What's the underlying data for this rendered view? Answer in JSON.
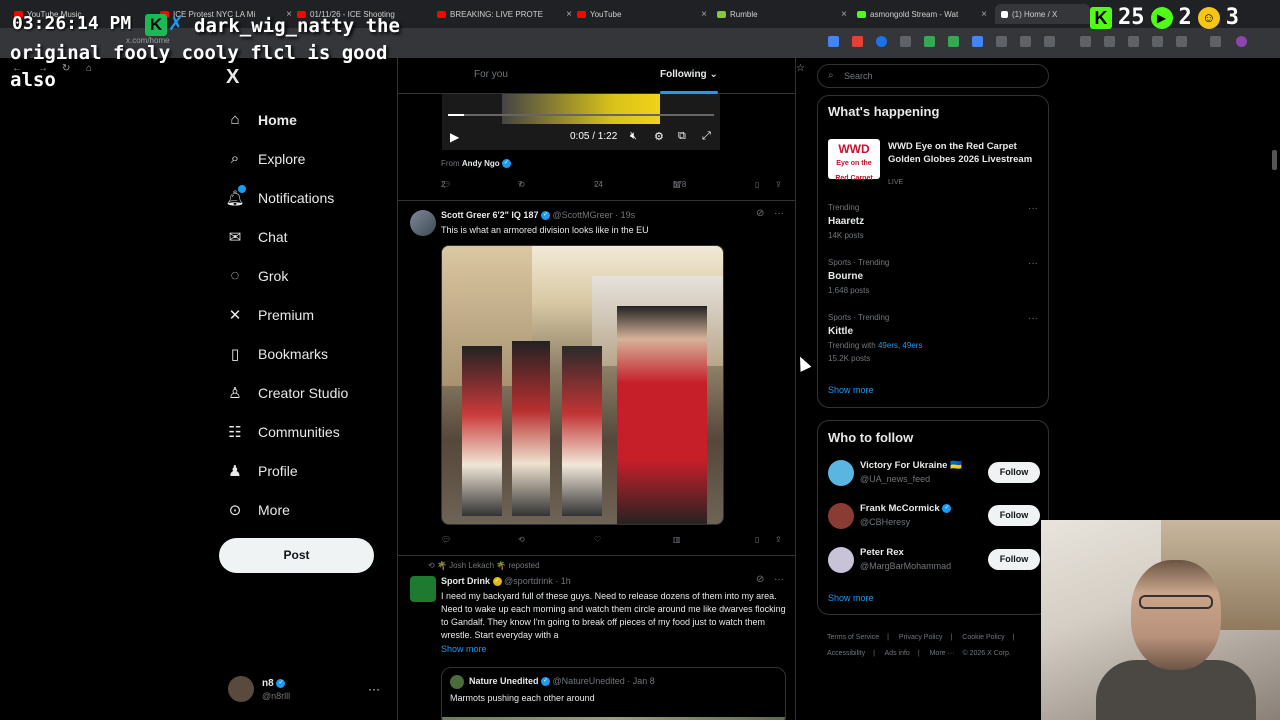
{
  "browser": {
    "tabs": [
      {
        "title": "YouTube Music",
        "color": "#ff0000"
      },
      {
        "title": "ICE Protest NYC LA Mi",
        "color": "#ff0000"
      },
      {
        "title": "01/11/26 - ICE Shooting",
        "color": "#ff0000"
      },
      {
        "title": "BREAKING: LIVE PROTE",
        "color": "#ff0000"
      },
      {
        "title": "YouTube",
        "color": "#ff0000"
      },
      {
        "title": "Rumble",
        "color": "#85c742"
      },
      {
        "title": "asmongold Stream - Wat",
        "color": "#53fc18"
      },
      {
        "title": "(1) Home / X",
        "color": "#ffffff"
      }
    ],
    "url": "x.com/home"
  },
  "overlay": {
    "time": "03:26:14 PM",
    "username": "dark_wig_natty",
    "message_line1": "the",
    "message_line2": "original fooly cooly flcl is good",
    "message_line3": "also",
    "stat1": "25",
    "stat2": "2",
    "stat3": "3"
  },
  "sidebar": {
    "logo": "X",
    "items": [
      {
        "label": "Home",
        "icon": "⌂"
      },
      {
        "label": "Explore",
        "icon": "⌕"
      },
      {
        "label": "Notifications",
        "icon": "♫"
      },
      {
        "label": "Chat",
        "icon": "✉"
      },
      {
        "label": "Grok",
        "icon": "◌"
      },
      {
        "label": "Premium",
        "icon": "✕"
      },
      {
        "label": "Bookmarks",
        "icon": "▯"
      },
      {
        "label": "Creator Studio",
        "icon": "♙"
      },
      {
        "label": "Communities",
        "icon": "☷"
      },
      {
        "label": "Profile",
        "icon": "♟"
      },
      {
        "label": "More",
        "icon": "⊙"
      }
    ],
    "post_label": "Post",
    "account": {
      "name": "n8",
      "handle": "@n8rlll"
    }
  },
  "feed": {
    "tab_for_you": "For you",
    "tab_following": "Following",
    "video": {
      "time": "0:05 / 1:22",
      "from_label": "From",
      "from_name": "Andy Ngo"
    },
    "tweet0_actions": {
      "replies": "2",
      "reposts": "7",
      "likes": "24",
      "views": "578"
    },
    "tweet1": {
      "name": "Scott Greer 6'2\" IQ 187",
      "handle": "@ScottMGreer",
      "time": "· 19s",
      "text": "This is what an armored division looks like in the EU"
    },
    "tweet2": {
      "repost_label": "🌴 Josh Lekach 🌴 reposted",
      "name": "Sport Drink",
      "handle": "@sportdrink",
      "time": "· 1h",
      "text": "I need my backyard full of these guys. Need to release dozens of them into my area. Need to wake up each morning and watch them circle around me like dwarves flocking to Gandalf. They know I'm going to break off pieces of my food just to watch them wrestle. Start everyday with a",
      "show_more": "Show more",
      "quote": {
        "name": "Nature Unedited",
        "handle": "@NatureUnedited",
        "time": "· Jan 8",
        "text": "Marmots pushing each other around"
      }
    }
  },
  "right": {
    "search_placeholder": "Search",
    "happening_title": "What's happening",
    "live": {
      "title": "WWD Eye on the Red Carpet Golden Globes 2026 Livestream",
      "status": "LIVE",
      "logo_line1": "WWD",
      "logo_line2": "Eye on the",
      "logo_line3": "Red Carpet"
    },
    "trends": [
      {
        "context": "Trending",
        "name": "Haaretz",
        "posts": "14K posts"
      },
      {
        "context": "Sports · Trending",
        "name": "Bourne",
        "posts": "1,648 posts"
      },
      {
        "context": "Sports · Trending",
        "name": "Kittle",
        "with_label": "Trending with",
        "with_tags": "49ers, 49ers",
        "posts": "15.2K posts"
      }
    ],
    "show_more": "Show more",
    "wtf_title": "Who to follow",
    "wtf": [
      {
        "name": "Victory For Ukraine 🇺🇦",
        "handle": "@UA_news_feed",
        "button": "Follow",
        "color": "#58b6e0"
      },
      {
        "name": "Frank McCormick",
        "handle": "@CBHeresy",
        "button": "Follow",
        "color": "#8a3b34"
      },
      {
        "name": "Peter Rex",
        "handle": "@MargBarMohammad",
        "button": "Follow",
        "color": "#c9c3d8"
      }
    ],
    "wtf_show_more": "Show more",
    "footer": [
      "Terms of Service",
      "|",
      "Privacy Policy",
      "|",
      "Cookie Policy",
      "|",
      "Accessibility",
      "|",
      "Ads info",
      "|",
      "More ···",
      "© 2026 X Corp."
    ]
  }
}
